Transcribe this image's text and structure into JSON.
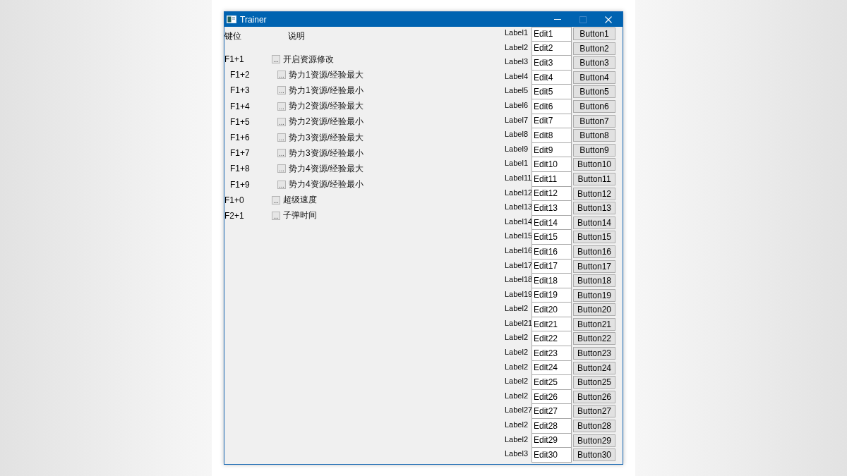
{
  "window": {
    "title": "Trainer",
    "buttons": [
      {
        "kind": "minimize",
        "disabled": false
      },
      {
        "kind": "maximize",
        "disabled": true
      },
      {
        "kind": "close",
        "disabled": false
      }
    ]
  },
  "hotkeys": {
    "columns": [
      "键位",
      "说明"
    ],
    "items": [
      {
        "key": "F1+1",
        "label": "开启资源修改",
        "checked": false,
        "children": [
          {
            "key": "F1+2",
            "label": "势力1资源/经验最大",
            "checked": false
          },
          {
            "key": "F1+3",
            "label": "势力1资源/经验最小",
            "checked": false
          },
          {
            "key": "F1+4",
            "label": "势力2资源/经验最大",
            "checked": false
          },
          {
            "key": "F1+5",
            "label": "势力2资源/经验最小",
            "checked": false
          },
          {
            "key": "F1+6",
            "label": "势力3资源/经验最大",
            "checked": false
          },
          {
            "key": "F1+7",
            "label": "势力3资源/经验最小",
            "checked": false
          },
          {
            "key": "F1+8",
            "label": "势力4资源/经验最大",
            "checked": false
          },
          {
            "key": "F1+9",
            "label": "势力4资源/经验最小",
            "checked": false
          }
        ]
      },
      {
        "key": "F1+0",
        "label": "超级速度",
        "checked": false
      },
      {
        "key": "F2+1",
        "label": "子弹时间",
        "checked": false
      }
    ]
  },
  "controls": [
    {
      "label": "Label1",
      "edit": "Edit1",
      "button": "Button1"
    },
    {
      "label": "Label2",
      "edit": "Edit2",
      "button": "Button2"
    },
    {
      "label": "Label3",
      "edit": "Edit3",
      "button": "Button3"
    },
    {
      "label": "Label4",
      "edit": "Edit4",
      "button": "Button4"
    },
    {
      "label": "Label5",
      "edit": "Edit5",
      "button": "Button5"
    },
    {
      "label": "Label6",
      "edit": "Edit6",
      "button": "Button6"
    },
    {
      "label": "Label7",
      "edit": "Edit7",
      "button": "Button7"
    },
    {
      "label": "Label8",
      "edit": "Edit8",
      "button": "Button8"
    },
    {
      "label": "Label9",
      "edit": "Edit9",
      "button": "Button9"
    },
    {
      "label": "Label1",
      "edit": "Edit10",
      "button": "Button10"
    },
    {
      "label": "Label11",
      "edit": "Edit11",
      "button": "Button11"
    },
    {
      "label": "Label12",
      "edit": "Edit12",
      "button": "Button12"
    },
    {
      "label": "Label13",
      "edit": "Edit13",
      "button": "Button13"
    },
    {
      "label": "Label14",
      "edit": "Edit14",
      "button": "Button14"
    },
    {
      "label": "Label15",
      "edit": "Edit15",
      "button": "Button15"
    },
    {
      "label": "Label16",
      "edit": "Edit16",
      "button": "Button16"
    },
    {
      "label": "Label17",
      "edit": "Edit17",
      "button": "Button17"
    },
    {
      "label": "Label18",
      "edit": "Edit18",
      "button": "Button18"
    },
    {
      "label": "Label19",
      "edit": "Edit19",
      "button": "Button19"
    },
    {
      "label": "Label2",
      "edit": "Edit20",
      "button": "Button20"
    },
    {
      "label": "Label21",
      "edit": "Edit21",
      "button": "Button21"
    },
    {
      "label": "Label2",
      "edit": "Edit22",
      "button": "Button22"
    },
    {
      "label": "Label2",
      "edit": "Edit23",
      "button": "Button23"
    },
    {
      "label": "Label2",
      "edit": "Edit24",
      "button": "Button24"
    },
    {
      "label": "Label2",
      "edit": "Edit25",
      "button": "Button25"
    },
    {
      "label": "Label2",
      "edit": "Edit26",
      "button": "Button26"
    },
    {
      "label": "Label27",
      "edit": "Edit27",
      "button": "Button27"
    },
    {
      "label": "Label2",
      "edit": "Edit28",
      "button": "Button28"
    },
    {
      "label": "Label2",
      "edit": "Edit29",
      "button": "Button29"
    },
    {
      "label": "Label3",
      "edit": "Edit30",
      "button": "Button30"
    }
  ]
}
